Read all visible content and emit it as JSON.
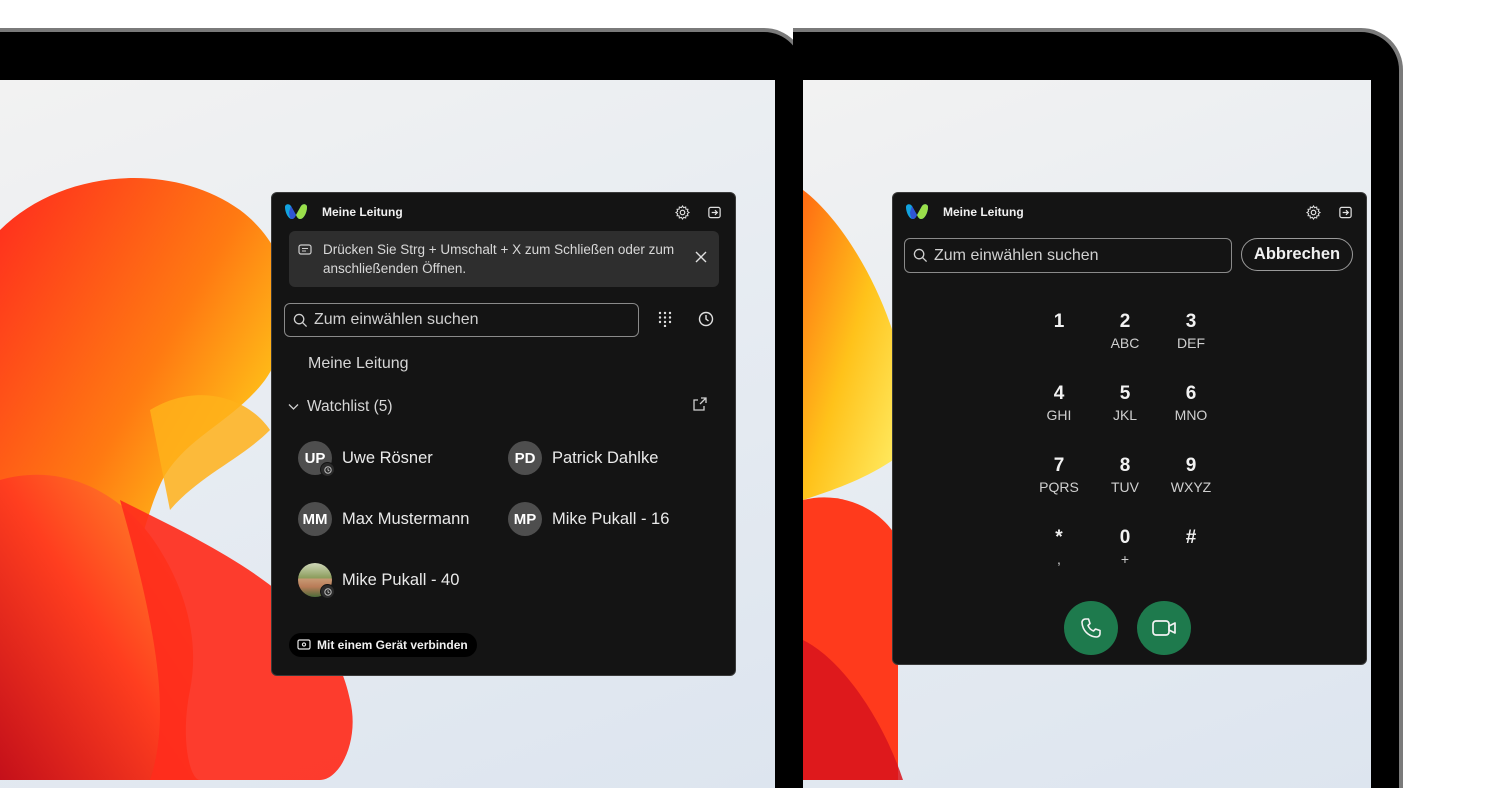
{
  "colors": {
    "panel_bg": "#141414",
    "banner_bg": "#2e2e2e",
    "call_green": "#1e7a4d",
    "device_frame": "#000000",
    "device_bezel": "#7a7a7a"
  },
  "left_panel": {
    "title": "Meine Leitung",
    "icons": [
      "webex-logo",
      "gear-icon",
      "sign-out-icon",
      "message-icon",
      "close-icon",
      "search-icon",
      "dialpad-icon",
      "clock-icon",
      "chevron-down-icon",
      "external-link-icon",
      "device-icon"
    ],
    "banner": "Drücken Sie Strg + Umschalt + X zum Schließen oder zum anschließenden Öffnen.",
    "search_placeholder": "Zum einwählen suchen",
    "line_label": "Meine Leitung",
    "watchlist_label": "Watchlist (5)",
    "contacts": [
      {
        "initials": "UP",
        "name": "Uwe Rösner",
        "status": "away"
      },
      {
        "initials": "PD",
        "name": "Patrick Dahlke"
      },
      {
        "initials": "MM",
        "name": "Max Mustermann"
      },
      {
        "initials": "MP",
        "name": "Mike Pukall - 16"
      },
      {
        "initials": "",
        "name": "Mike Pukall - 40",
        "photo": true,
        "status": "away"
      }
    ],
    "connect_button": "Mit einem Gerät verbinden"
  },
  "right_panel": {
    "title": "Meine Leitung",
    "search_placeholder": "Zum einwählen suchen",
    "cancel_button": "Abbrechen",
    "keys": [
      {
        "digit": "1",
        "letters": ""
      },
      {
        "digit": "2",
        "letters": "ABC"
      },
      {
        "digit": "3",
        "letters": "DEF"
      },
      {
        "digit": "4",
        "letters": "GHI"
      },
      {
        "digit": "5",
        "letters": "JKL"
      },
      {
        "digit": "6",
        "letters": "MNO"
      },
      {
        "digit": "7",
        "letters": "PQRS"
      },
      {
        "digit": "8",
        "letters": "TUV"
      },
      {
        "digit": "9",
        "letters": "WXYZ"
      },
      {
        "digit": "*",
        "letters": ","
      },
      {
        "digit": "0",
        "letters": "+"
      },
      {
        "digit": "#",
        "letters": ""
      }
    ],
    "call_buttons": [
      "phone-icon",
      "video-icon"
    ]
  }
}
